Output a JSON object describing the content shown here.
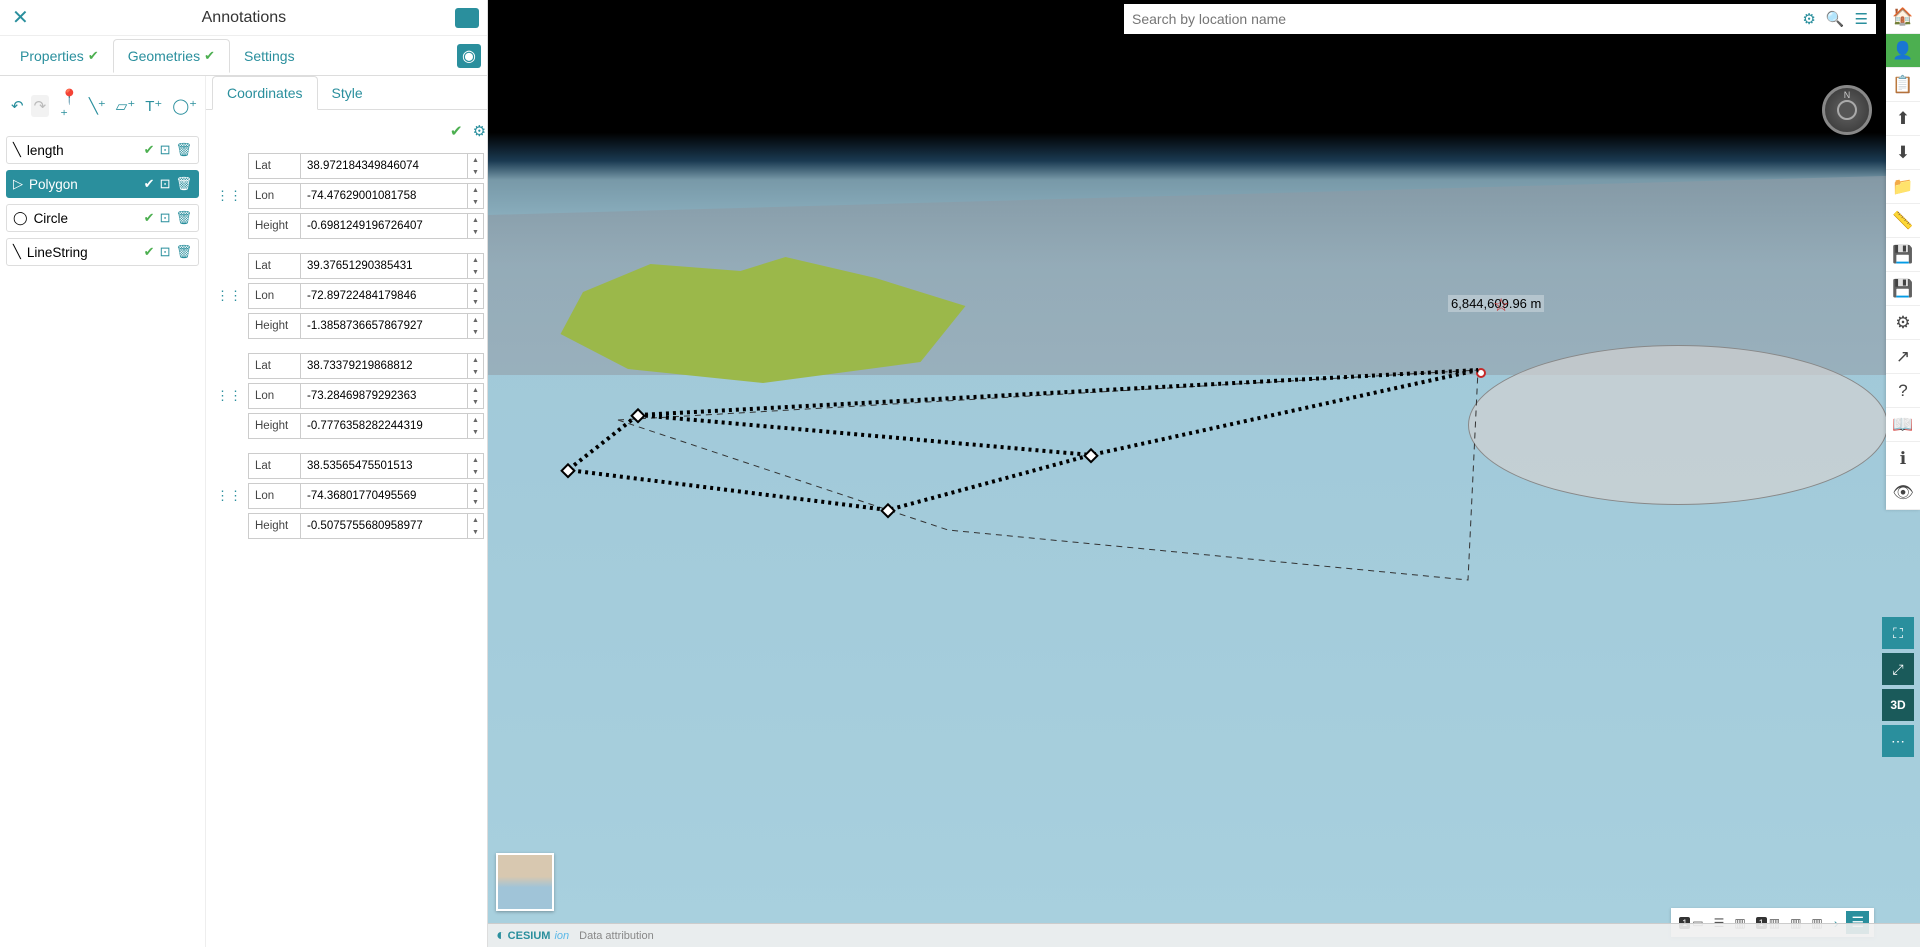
{
  "panel": {
    "title": "Annotations",
    "tabs": {
      "properties": "Properties",
      "geometries": "Geometries",
      "settings": "Settings"
    }
  },
  "toolbar": {
    "undo": "↶",
    "redo": "↷",
    "marker": "📍",
    "line": "📏",
    "polygon": "▱",
    "text": "T",
    "circle": "⭕"
  },
  "geometries": {
    "items": [
      {
        "icon": "╲",
        "label": "length"
      },
      {
        "icon": "▷",
        "label": "Polygon"
      },
      {
        "icon": "◯",
        "label": "Circle"
      },
      {
        "icon": "╲",
        "label": "LineString"
      }
    ]
  },
  "coordPanel": {
    "tabs": {
      "coordinates": "Coordinates",
      "style": "Style"
    },
    "labels": {
      "lat": "Lat",
      "lon": "Lon",
      "height": "Height"
    },
    "points": [
      {
        "lat": "38.972184349846074",
        "lon": "-74.47629001081758",
        "height": "-0.6981249196726407"
      },
      {
        "lat": "39.37651290385431",
        "lon": "-72.89722484179846",
        "height": "-1.3858736657867927"
      },
      {
        "lat": "38.73379219868812",
        "lon": "-73.28469879292363",
        "height": "-0.7776358282244319"
      },
      {
        "lat": "38.53565475501513",
        "lon": "-74.36801770495569",
        "height": "-0.5075755680958977"
      }
    ]
  },
  "search": {
    "placeholder": "Search by location name"
  },
  "map": {
    "distanceLabel": "6,844,609.96 m"
  },
  "br": {
    "threed": "3D"
  },
  "bottomStatus": {
    "badge": "1"
  },
  "footer": {
    "cesium": "CESIUM",
    "ion": "ion",
    "attribution": "Data attribution"
  }
}
